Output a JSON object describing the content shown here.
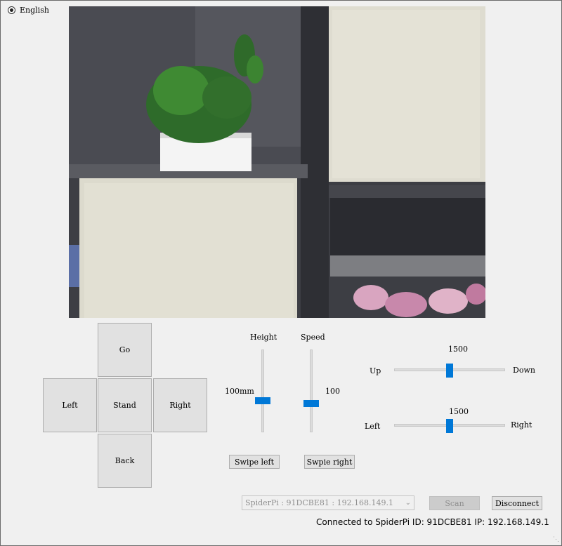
{
  "language": {
    "label": "English",
    "selected": true
  },
  "camera_feed": {
    "alt": "camera-feed-icon"
  },
  "direction_pad": {
    "go": "Go",
    "left": "Left",
    "stand": "Stand",
    "right": "Right",
    "back": "Back"
  },
  "height_slider": {
    "label": "Height",
    "value_text": "100mm",
    "level": 0.45
  },
  "speed_slider": {
    "label": "Speed",
    "value_text": "100",
    "level": 0.37
  },
  "updown_slider": {
    "value": "1500",
    "left_label": "Up",
    "right_label": "Down",
    "level": 0.5
  },
  "leftright_slider": {
    "value": "1500",
    "left_label": "Left",
    "right_label": "Right",
    "level": 0.5
  },
  "swipe_left": "Swipe left",
  "swipe_right": "Swpie right",
  "device_select": {
    "value": "SpiderPi : 91DCBE81 : 192.168.149.1"
  },
  "scan_button": "Scan",
  "disconnect_button": "Disconnect",
  "status_text": "Connected to SpiderPi  ID: 91DCBE81  IP: 192.168.149.1"
}
